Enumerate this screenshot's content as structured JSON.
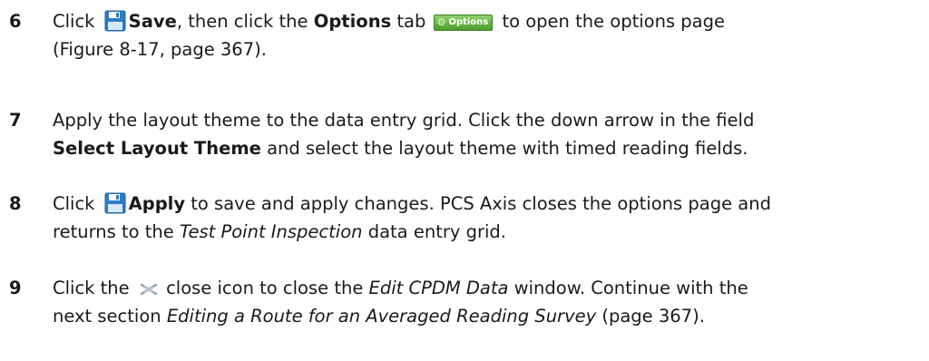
{
  "steps": [
    {
      "number": "6",
      "t1": "Click ",
      "save_label": "Save",
      "t2": ", then click the ",
      "options_label": "Options",
      "t3": " tab ",
      "options_tab_label": "Options",
      "t4": " to open the options page",
      "line2": "(Figure 8-17, page 367)."
    },
    {
      "number": "7",
      "line1": "Apply the layout theme to the data entry grid. Click the down arrow in the field",
      "field_label": "Select Layout Theme",
      "t2": " and select the layout theme with timed reading fields."
    },
    {
      "number": "8",
      "t1": "Click ",
      "apply_label": "Apply",
      "t2": " to save and apply changes. PCS Axis closes the options page and",
      "t3": "returns to the ",
      "grid_name": "Test Point Inspection",
      "t4": " data entry grid."
    },
    {
      "number": "9",
      "t1": "Click the ",
      "t2": " close icon to close the ",
      "window_name": "Edit CPDM Data",
      "t3": " window. Continue with the",
      "t4": "next section ",
      "section_name": "Editing a Route for an Averaged Reading Survey",
      "t5": " (page 367)."
    }
  ],
  "icons": {
    "save": "floppy-disk-icon",
    "close": "close-icon",
    "gear": "gear-icon"
  },
  "colors": {
    "save_icon": "#2c7cc7",
    "options_tab": "#5aaa36",
    "close_icon": "#8aa0b8"
  }
}
